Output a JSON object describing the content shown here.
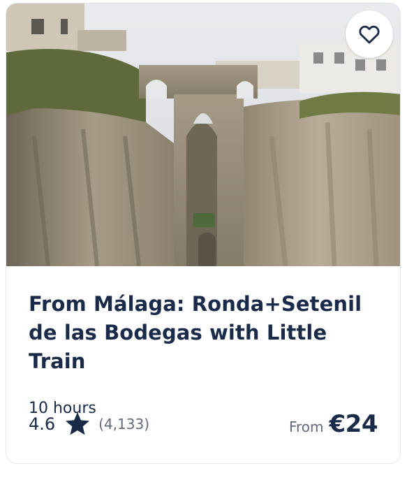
{
  "card": {
    "image_alt": "Puente Nuevo bridge spanning the gorge in Ronda",
    "wishlist_icon": "heart-outline-icon",
    "title": "From Málaga: Ronda+Setenil de las Bodegas with Little Train",
    "duration": "10 hours",
    "rating": "4.6",
    "rating_icon": "star-icon",
    "review_count": "(4,133)",
    "price_prefix": "From",
    "price": "€24"
  },
  "colors": {
    "text_primary": "#1a2b49",
    "text_secondary": "#63687a",
    "card_border": "#e3e6ea"
  }
}
